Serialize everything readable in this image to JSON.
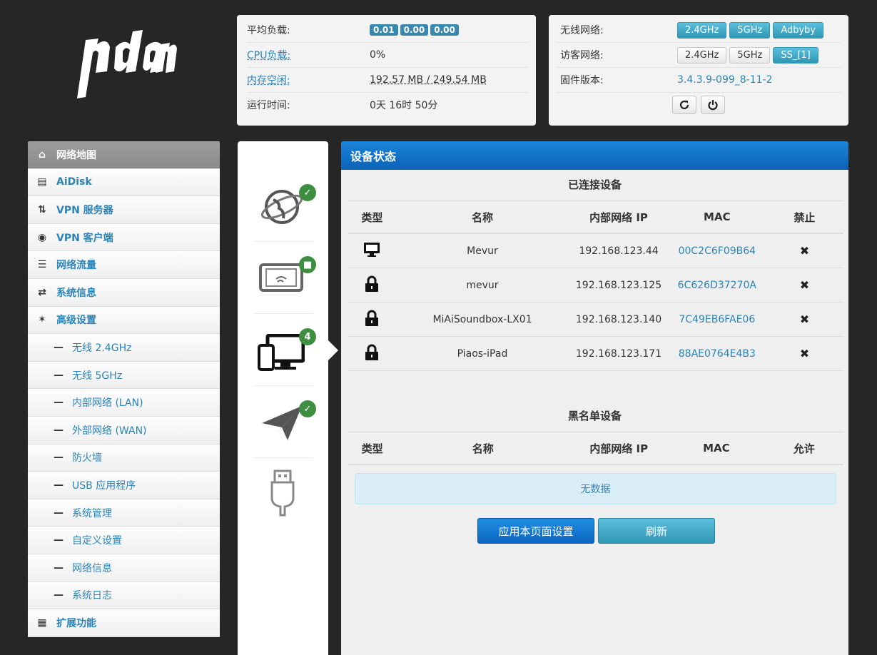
{
  "status": {
    "load_label": "平均负载:",
    "load_values": [
      "0.01",
      "0.00",
      "0.00"
    ],
    "cpu_label": "CPU负载:",
    "cpu_value": "0%",
    "mem_label": "内存空闲:",
    "mem_value": "192.57 MB / 249.54 MB",
    "uptime_label": "运行时间:",
    "uptime_value": "0天 16时 50分"
  },
  "wireless": {
    "wifi_label": "无线网络:",
    "wifi_buttons": [
      "2.4GHz",
      "5GHz",
      "Adbyby"
    ],
    "guest_label": "访客网络:",
    "guest_buttons": [
      "2.4GHz",
      "5GHz",
      "SS_[1]"
    ],
    "fw_label": "固件版本:",
    "fw_value": "3.4.3.9-099_8-11-2"
  },
  "sidebar": {
    "items": [
      {
        "label": "网络地图",
        "icon": "home-icon"
      },
      {
        "label": "AiDisk",
        "icon": "hdd-icon"
      },
      {
        "label": "VPN 服务器",
        "icon": "retweet-icon"
      },
      {
        "label": "VPN 客户端",
        "icon": "globe-icon"
      },
      {
        "label": "网络流量",
        "icon": "list-icon"
      },
      {
        "label": "系统信息",
        "icon": "random-icon"
      },
      {
        "label": "高级设置",
        "icon": "wrench-icon"
      },
      {
        "label": "无线 2.4GHz"
      },
      {
        "label": "无线 5GHz"
      },
      {
        "label": "内部网络 (LAN)"
      },
      {
        "label": "外部网络 (WAN)"
      },
      {
        "label": "防火墙"
      },
      {
        "label": "USB 应用程序"
      },
      {
        "label": "系统管理"
      },
      {
        "label": "自定义设置"
      },
      {
        "label": "网络信息"
      },
      {
        "label": "系统日志"
      },
      {
        "label": "扩展功能",
        "icon": "grid-icon"
      }
    ]
  },
  "iconcol": {
    "client_count": "4"
  },
  "main": {
    "title": "设备状态",
    "connected_title": "已连接设备",
    "headers": [
      "类型",
      "名称",
      "内部网络 IP",
      "MAC",
      "禁止"
    ],
    "devices": [
      {
        "type": "desktop-icon",
        "name": "Mevur",
        "ip": "192.168.123.44",
        "mac": "00C2C6F09B64"
      },
      {
        "type": "lock-icon",
        "name": "mevur",
        "ip": "192.168.123.125",
        "mac": "6C626D37270A"
      },
      {
        "type": "lock-icon",
        "name": "MiAiSoundbox-LX01",
        "ip": "192.168.123.140",
        "mac": "7C49EB6FAE06"
      },
      {
        "type": "lock-icon",
        "name": "Piaos-iPad",
        "ip": "192.168.123.171",
        "mac": "88AE0764E4B3"
      }
    ],
    "blacklist_title": "黑名单设备",
    "blacklist_headers": [
      "类型",
      "名称",
      "内部网络 IP",
      "MAC",
      "允许"
    ],
    "empty_text": "无数据",
    "apply_label": "应用本页面设置",
    "refresh_label": "刷新"
  },
  "colors": {
    "accent": "#0a63b8",
    "link": "#2a84b8",
    "ok": "#3e8e41",
    "info_bg": "#d9edf7"
  }
}
